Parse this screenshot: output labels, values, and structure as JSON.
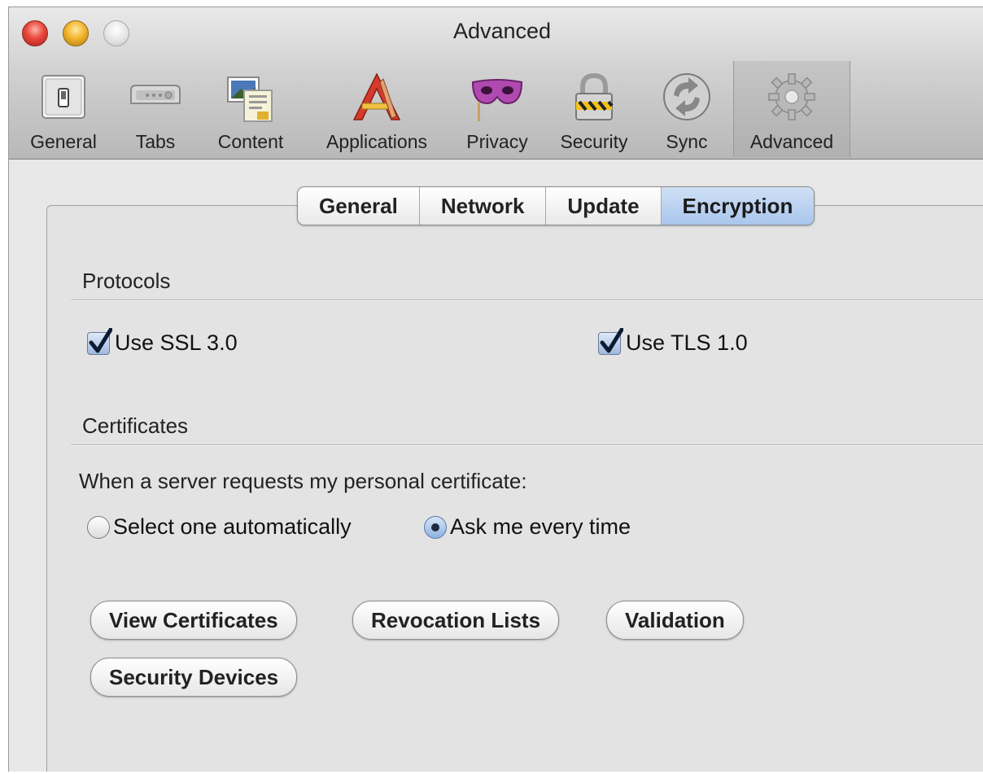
{
  "window": {
    "title": "Advanced"
  },
  "toolbar": {
    "items": [
      {
        "label": "General",
        "icon": "switch-icon"
      },
      {
        "label": "Tabs",
        "icon": "tabs-icon"
      },
      {
        "label": "Content",
        "icon": "content-icon"
      },
      {
        "label": "Applications",
        "icon": "applications-icon"
      },
      {
        "label": "Privacy",
        "icon": "mask-icon"
      },
      {
        "label": "Security",
        "icon": "padlock-icon"
      },
      {
        "label": "Sync",
        "icon": "sync-icon"
      },
      {
        "label": "Advanced",
        "icon": "gear-icon"
      }
    ],
    "active": "Advanced"
  },
  "tabs": {
    "items": [
      "General",
      "Network",
      "Update",
      "Encryption"
    ],
    "active": "Encryption"
  },
  "protocols": {
    "title": "Protocols",
    "ssl_label": "Use SSL 3.0",
    "ssl_checked": true,
    "tls_label": "Use TLS 1.0",
    "tls_checked": true
  },
  "certificates": {
    "title": "Certificates",
    "prompt": "When a server requests my personal certificate:",
    "option_auto": "Select one automatically",
    "option_ask": "Ask me every time",
    "selected": "Ask me every time"
  },
  "buttons": {
    "view_certificates": "View Certificates",
    "revocation_lists": "Revocation Lists",
    "validation": "Validation",
    "security_devices": "Security Devices"
  },
  "colors": {
    "active_tab": "#a9c6ec",
    "checkbox": "#9fb9de"
  }
}
